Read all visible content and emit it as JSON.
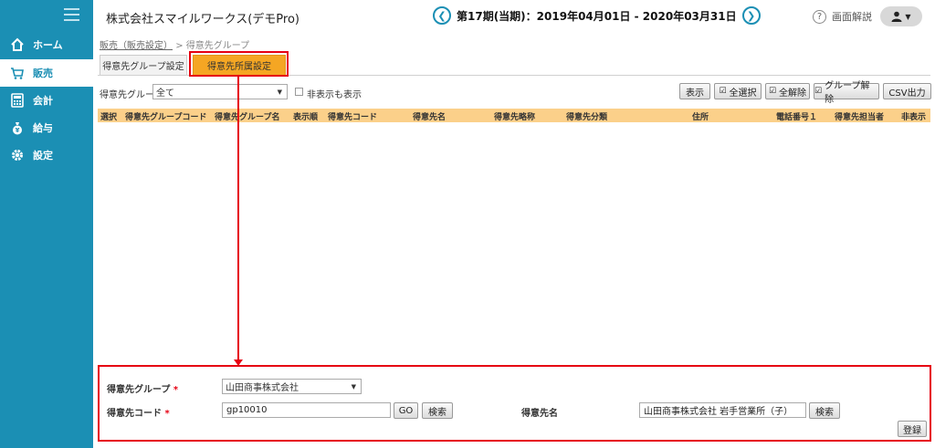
{
  "sidebar": {
    "items": [
      {
        "label": "ホーム",
        "icon": "home-icon"
      },
      {
        "label": "販売",
        "icon": "cart-icon"
      },
      {
        "label": "会計",
        "icon": "calculator-icon"
      },
      {
        "label": "給与",
        "icon": "money-bag-icon"
      },
      {
        "label": "設定",
        "icon": "gear-icon"
      }
    ],
    "active_index": 1,
    "color": "#1b8fb4"
  },
  "header": {
    "company": "株式会社スマイルワークス(デモPro)",
    "period": "第17期(当期)：2019年04月01日 - 2020年03月31日",
    "help_label": "画面解説",
    "prev_icon": "chevron-left-icon",
    "next_icon": "chevron-right-icon"
  },
  "breadcrumb": {
    "parent": "販売（販売設定）",
    "separator": ">",
    "current": "得意先グループ"
  },
  "tabs": [
    {
      "label": "得意先グループ設定"
    },
    {
      "label": "得意先所属設定",
      "active": true
    }
  ],
  "filter": {
    "label": "得意先グループ",
    "value": "全て",
    "show_hidden_label": "非表示も表示"
  },
  "toolbar": {
    "show": "表示",
    "select_all": "全選択",
    "deselect_all": "全解除",
    "group_release": "グループ解除",
    "csv": "CSV出力"
  },
  "table": {
    "columns": [
      "選択",
      "得意先グループコード",
      "得意先グループ名",
      "表示順",
      "得意先コード",
      "得意先名",
      "得意先略称",
      "得意先分類",
      "住所",
      "電話番号１",
      "得意先担当者",
      "非表示"
    ]
  },
  "form": {
    "group_label": "得意先グループ",
    "group_value": "山田商事株式会社",
    "code_label": "得意先コード",
    "code_value": "gp10010",
    "go": "GO",
    "search": "検索",
    "name_label": "得意先名",
    "name_value": "山田商事株式会社 岩手営業所（子）",
    "name_search": "検索",
    "register": "登録",
    "required_mark": "*"
  },
  "colors": {
    "accent": "#f5a623",
    "highlight": "#e60012"
  }
}
